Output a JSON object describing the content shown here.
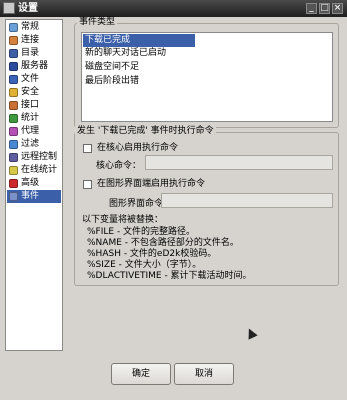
{
  "window": {
    "title": "设置"
  },
  "sidebar": {
    "items": [
      {
        "label": "常规",
        "icon": "general-icon",
        "color": "#6aa0d8"
      },
      {
        "label": "连接",
        "icon": "connection-icon",
        "color": "#d4823c"
      },
      {
        "label": "目录",
        "icon": "folder-icon",
        "color": "#3f5fa6"
      },
      {
        "label": "服务器",
        "icon": "server-icon",
        "color": "#2b4c9e"
      },
      {
        "label": "文件",
        "icon": "file-icon",
        "color": "#3a63b8"
      },
      {
        "label": "安全",
        "icon": "lock-icon",
        "color": "#e0b233"
      },
      {
        "label": "接口",
        "icon": "interface-icon",
        "color": "#c96f33"
      },
      {
        "label": "统计",
        "icon": "statistics-icon",
        "color": "#3f9a3f"
      },
      {
        "label": "代理",
        "icon": "proxy-icon",
        "color": "#b44fb4"
      },
      {
        "label": "过滤",
        "icon": "filter-icon",
        "color": "#4a8ad4"
      },
      {
        "label": "远程控制",
        "icon": "remote-control-icon",
        "color": "#5f5f9f"
      },
      {
        "label": "在线统计",
        "icon": "online-statistics-icon",
        "color": "#d8c84a"
      },
      {
        "label": "高级",
        "icon": "advanced-icon",
        "color": "#cc2a2a"
      },
      {
        "label": "事件",
        "icon": "events-icon",
        "color": "#7a90c8"
      }
    ],
    "selected_index": 13
  },
  "event_types": {
    "group_label": "事件类型",
    "items": [
      "下载已完成",
      "新的聊天对话已启动",
      "磁盘空间不足",
      "最后阶段出错"
    ],
    "selected_index": 0
  },
  "actions": {
    "group_label": "发生 '下载已完成' 事件时执行命令",
    "core_checkbox_label": "在核心启用执行命令",
    "core_command_label": "核心命令：",
    "core_command_value": "",
    "gui_checkbox_label": "在图形界面端启用执行命令",
    "gui_command_label": "图形界面命令：",
    "gui_command_value": "",
    "replace_header": "以下变量将被替换：",
    "variables": [
      "%FILE - 文件的完整路径。",
      "%NAME - 不包含路径部分的文件名。",
      "%HASH - 文件的eD2k校验码。",
      "%SIZE - 文件大小（字节）。",
      "%DLACTIVETIME - 累计下载活动时间。"
    ]
  },
  "buttons": {
    "ok": "确定",
    "cancel": "取消"
  },
  "colors": {
    "selection": "#3b5fa8",
    "background": "#d6d3ce"
  }
}
